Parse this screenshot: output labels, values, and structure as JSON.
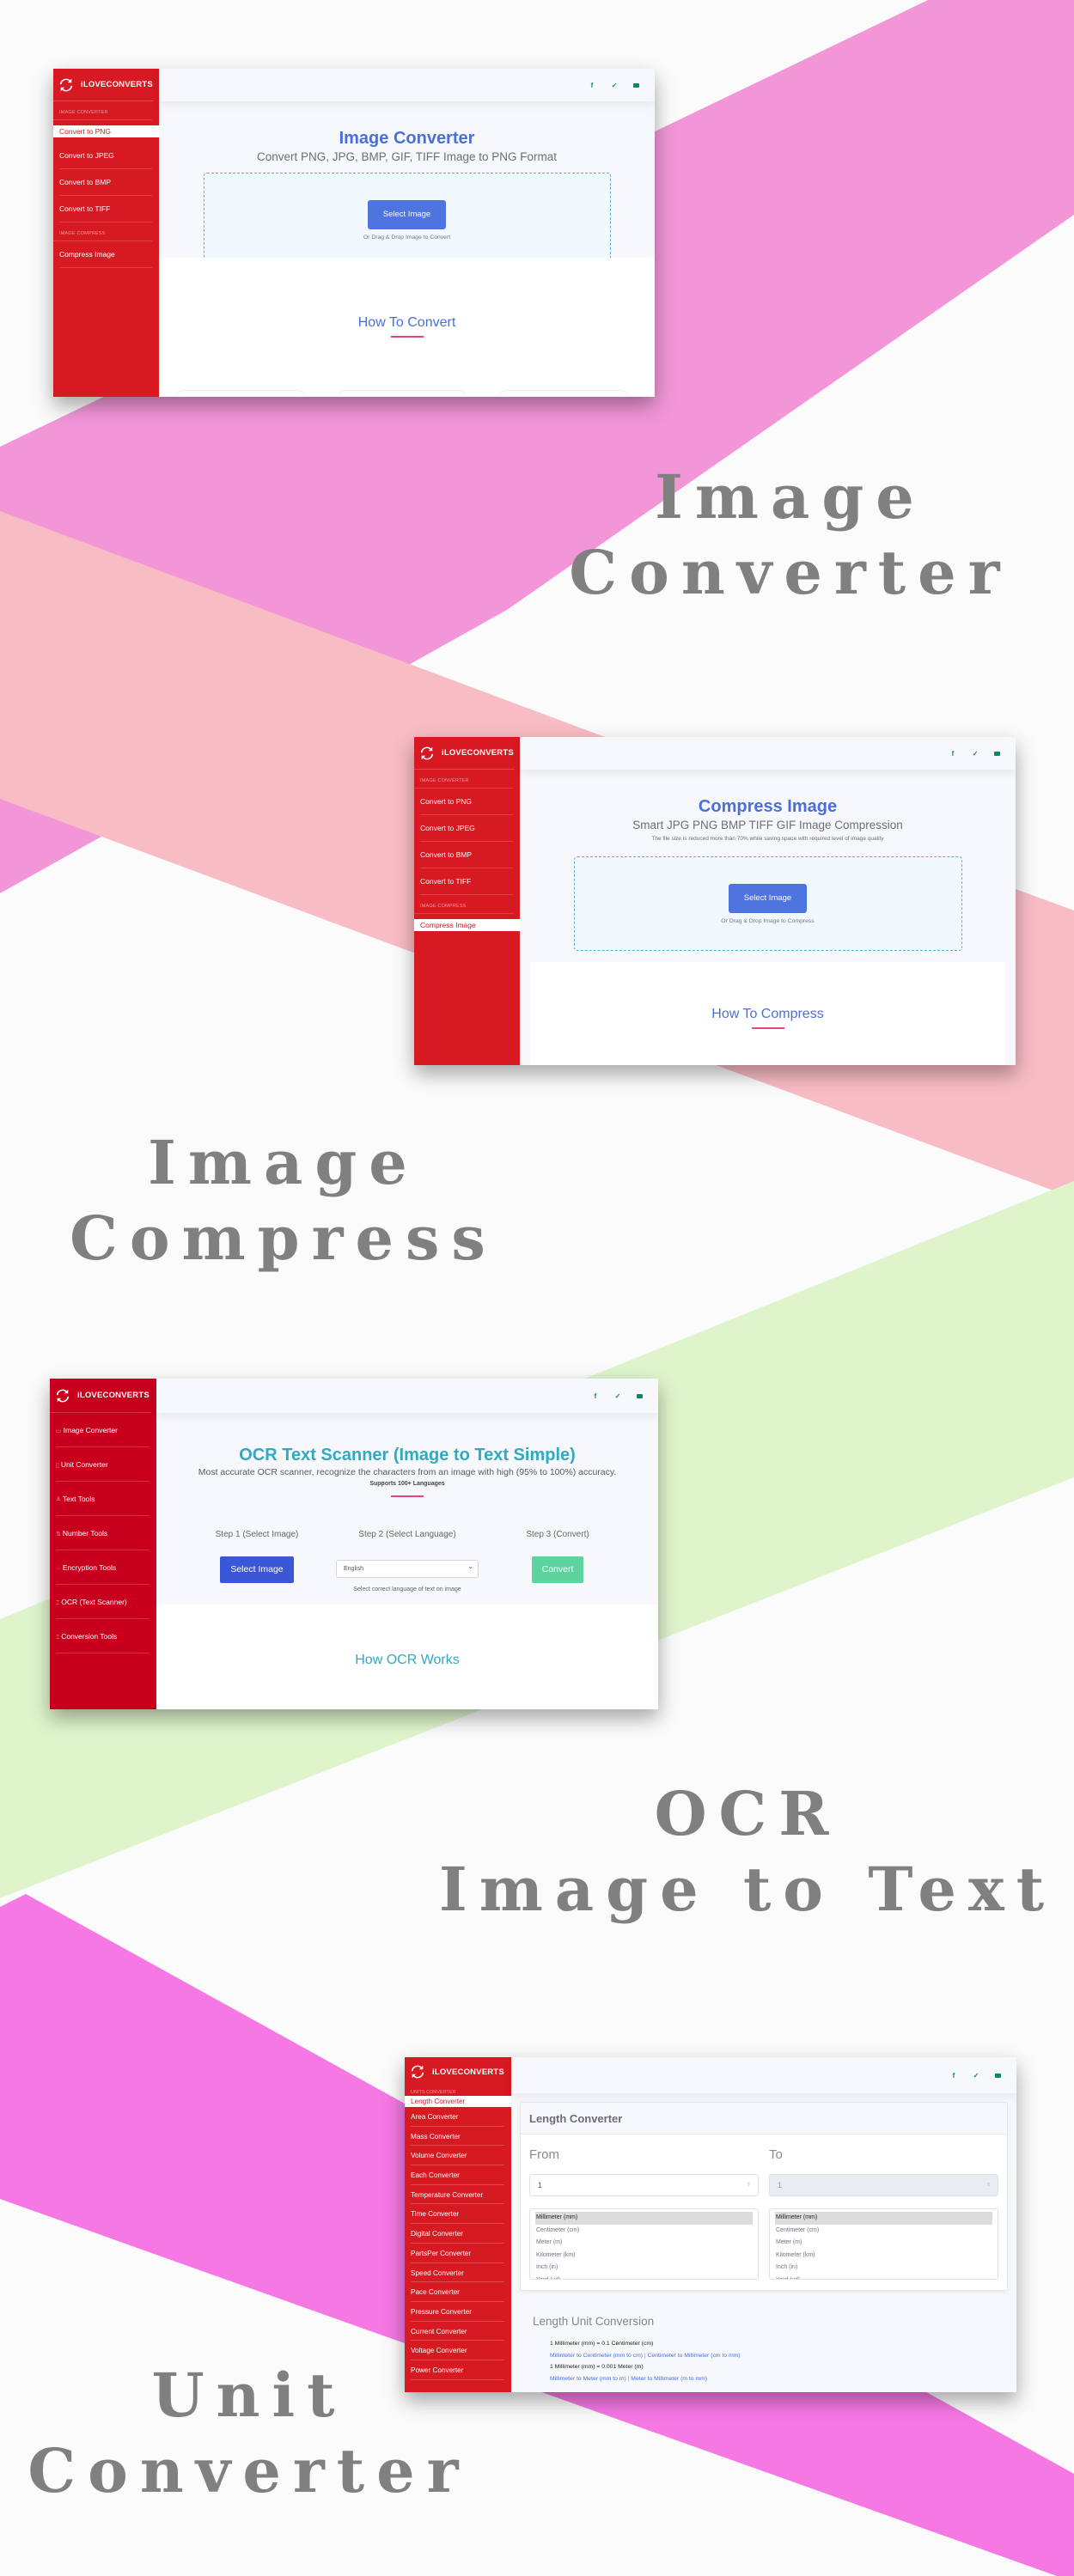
{
  "colors": {
    "sidebar_red": "#d71921",
    "accent_blue": "#4a6fd8",
    "ocr_teal": "#2faac3",
    "convert_green": "#5dd39e",
    "social_green": "#0c8a5a",
    "underline_pink": "#e9447a",
    "band_purple": "#f296d8",
    "band_pink": "#f8bcc4",
    "band_green": "#def5cc",
    "band_magenta": "#f578e4",
    "headline_gray": "#808080"
  },
  "headlines": {
    "image_converter": [
      "Image",
      "Converter"
    ],
    "image_compress": [
      "Image",
      "Compress"
    ],
    "ocr": [
      "OCR",
      "Image to Text"
    ],
    "unit_converter": [
      "Unit",
      "Converter"
    ]
  },
  "brand": {
    "name": "iLOVECONVERTS",
    "logo_icon": "sync-arrows-icon"
  },
  "social_icons": [
    "facebook-icon",
    "twitter-icon",
    "youtube-icon"
  ],
  "social_glyphs": {
    "facebook": "f",
    "twitter": "🐦"
  },
  "converter_sidebar": {
    "section_image_converter": "IMAGE CONVERTER",
    "section_image_compress": "IMAGE COMPRESS",
    "items": [
      "Convert to PNG",
      "Convert to JPEG",
      "Convert to BMP",
      "Convert to TIFF",
      "Compress Image"
    ]
  },
  "panel_converter": {
    "active_item": "Convert to PNG",
    "title": "Image Converter",
    "subtitle": "Convert PNG, JPG, BMP, GIF, TIFF Image to PNG Format",
    "button": "Select Image",
    "drop_hint": "Or Drag & Drop Image to Convert",
    "how_to": "How To Convert"
  },
  "panel_compress": {
    "active_item": "Compress Image",
    "title": "Compress Image",
    "subtitle": "Smart JPG PNG BMP TIFF GIF Image Compression",
    "description": "The file size is reduced more than 70% while saving space with required level of image quality",
    "button": "Select Image",
    "drop_hint": "Or Drag & Drop Image to Compress",
    "how_to": "How To Compress"
  },
  "panel_ocr": {
    "sidebar": [
      {
        "icon": "image-icon",
        "glyph": "▭",
        "label": "Image Converter"
      },
      {
        "icon": "unit-icon",
        "glyph": "▯",
        "label": "Unit Converter"
      },
      {
        "icon": "text-icon",
        "glyph": "≜",
        "label": "Text Tools"
      },
      {
        "icon": "sort-numbers-icon",
        "glyph": "⇅",
        "label": "Number Tools"
      },
      {
        "icon": "encryption-icon",
        "glyph": "⁘",
        "label": "Encryption Tools"
      },
      {
        "icon": "ocr-icon",
        "glyph": "⌶",
        "label": "OCR (Text Scanner)"
      },
      {
        "icon": "conversion-icon",
        "glyph": "⌶",
        "label": "Conversion Tools"
      }
    ],
    "title": "OCR Text Scanner (Image to Text Simple)",
    "subtitle": "Most accurate OCR scanner, recognize the characters from an image with high (95% to 100%) accuracy.",
    "support": "Supports 100+ Languages",
    "step1": "Step 1 (Select Image)",
    "step2": "Step 2 (Select Language)",
    "step3": "Step 3 (Convert)",
    "select_button": "Select Image",
    "language_selected": "English",
    "language_hint": "Select correct language of text on image",
    "convert_button": "Convert",
    "how_to": "How OCR Works"
  },
  "panel_unit": {
    "section_label": "UNITS CONVERTER",
    "sidebar": [
      "Length Converter",
      "Area Converter",
      "Mass Converter",
      "Volume Converter",
      "Each Converter",
      "Temperature Converter",
      "Time Converter",
      "Digital Converter",
      "PartsPer Converter",
      "Speed Converter",
      "Pace Converter",
      "Pressure Converter",
      "Current Converter",
      "Voltage Converter",
      "Power Converter"
    ],
    "card_title": "Length Converter",
    "from_label": "From",
    "to_label": "To",
    "from_value": "1",
    "to_value": "1",
    "units": [
      "Millimeter (mm)",
      "Centimeter (cm)",
      "Meter (m)",
      "Kilometer (km)",
      "Inch (in)",
      "Yard (yd)"
    ],
    "selected_from": "Millimeter (mm)",
    "selected_to": "Millimeter (mm)",
    "conversion_title": "Length Unit Conversion",
    "conversions": [
      {
        "text": "1 Millimeter (mm) = 0.1 Centimeter (cm)",
        "link_a": "Millimeter to Centimeter (mm to cm)",
        "link_b": "Centimeter to Millimeter (cm to mm)"
      },
      {
        "text": "1 Millimeter (mm) = 0.001 Meter (m)",
        "link_a": "Millimeter to Meter (mm to m)",
        "link_b": "Meter to Millimeter (m to mm)"
      }
    ]
  }
}
